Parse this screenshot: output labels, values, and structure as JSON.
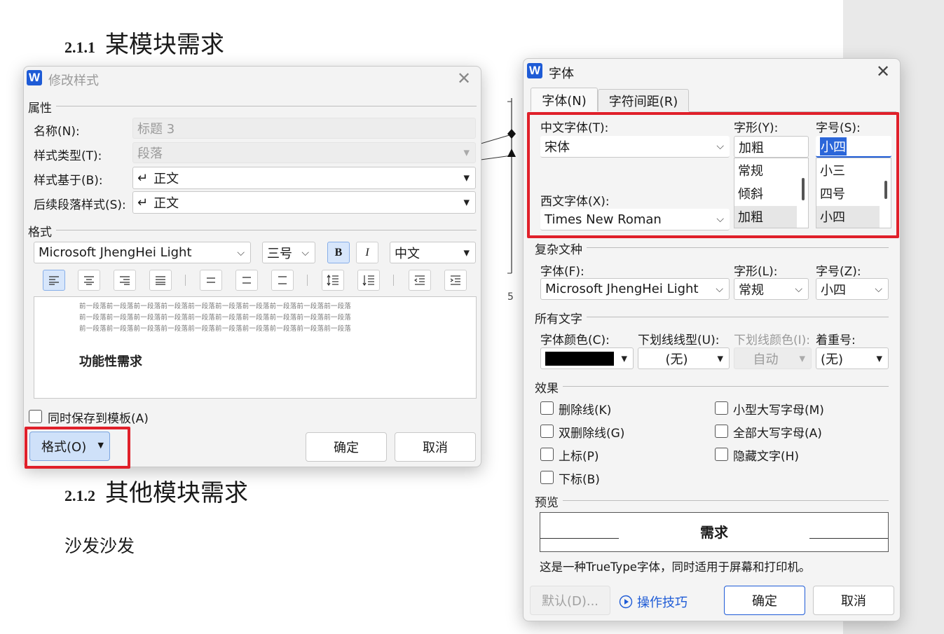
{
  "document": {
    "heading1_num": "2.1.1",
    "heading1_text": "某模块需求",
    "heading2_num": "2.1.2",
    "heading2_text": "其他模块需求",
    "body_text": "沙发沙发",
    "diagram_label": "5"
  },
  "modify_style": {
    "title": "修改样式",
    "section_props": "属性",
    "name_label": "名称(N):",
    "name_value": "标题 3",
    "type_label": "样式类型(T):",
    "type_value": "段落",
    "based_label": "样式基于(B):",
    "based_value": "正文",
    "next_label": "后续段落样式(S):",
    "next_value": "正文",
    "section_format": "格式",
    "font_name": "Microsoft JhengHei Light",
    "font_size": "三号",
    "bold_label": "B",
    "italic_label": "I",
    "lang": "中文",
    "preview_prev": "前一段落前一段落前一段落前一段落前一段落前一段落前一段落前一段落前一段落前一段落",
    "preview_text": "功能性需求",
    "save_template": "同时保存到模板(A)",
    "format_btn": "格式(O)",
    "ok": "确定",
    "cancel": "取消"
  },
  "font_dialog": {
    "title": "字体",
    "tab_font": "字体(N)",
    "tab_spacing": "字符间距(R)",
    "cn_font_label": "中文字体(T):",
    "cn_font_value": "宋体",
    "style_label": "字形(Y):",
    "style_value": "加粗",
    "size_label": "字号(S):",
    "size_value": "小四",
    "style_list": [
      "常规",
      "倾斜",
      "加粗"
    ],
    "size_list": [
      "小三",
      "四号",
      "小四"
    ],
    "west_font_label": "西文字体(X):",
    "west_font_value": "Times New Roman",
    "section_complex": "复杂文种",
    "complex_font_label": "字体(F):",
    "complex_font_value": "Microsoft JhengHei Light",
    "complex_style_label": "字形(L):",
    "complex_style_value": "常规",
    "complex_size_label": "字号(Z):",
    "complex_size_value": "小四",
    "section_all": "所有文字",
    "color_label": "字体颜色(C):",
    "color_value": "#000000",
    "underline_label": "下划线线型(U):",
    "underline_value": "(无)",
    "underline_color_label": "下划线颜色(I):",
    "underline_color_value": "自动",
    "emphasis_label": "着重号:",
    "emphasis_value": "(无)",
    "section_effects": "效果",
    "effects_left": [
      "删除线(K)",
      "双删除线(G)",
      "上标(P)",
      "下标(B)"
    ],
    "effects_right": [
      "小型大写字母(M)",
      "全部大写字母(A)",
      "隐藏文字(H)"
    ],
    "section_preview": "预览",
    "preview_text": "需求",
    "truetype_note": "这是一种TrueType字体，同时适用于屏幕和打印机。",
    "default_btn": "默认(D)...",
    "tips_btn": "操作技巧",
    "ok": "确定",
    "cancel": "取消"
  },
  "colors": {
    "accent": "#1e5bd6",
    "highlight_red": "#e0202a",
    "format_btn_bg": "#cfe1f9"
  }
}
